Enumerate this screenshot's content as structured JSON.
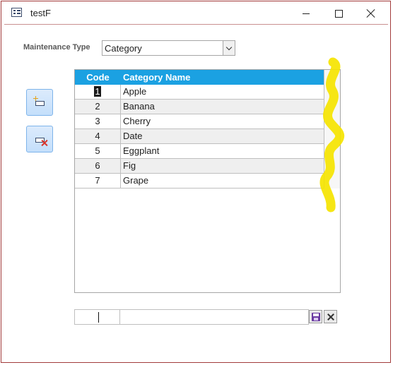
{
  "window": {
    "title": "testF",
    "accent_color": "#a23b3b"
  },
  "form": {
    "maintenance_label": "Maintenance Type",
    "maintenance_value": "Category"
  },
  "grid": {
    "header_color": "#1ba1e2",
    "columns": [
      "Code",
      "Category Name"
    ],
    "rows": [
      {
        "code": "1",
        "name": "Apple"
      },
      {
        "code": "2",
        "name": "Banana"
      },
      {
        "code": "3",
        "name": "Cherry"
      },
      {
        "code": "4",
        "name": "Date"
      },
      {
        "code": "5",
        "name": "Eggplant"
      },
      {
        "code": "6",
        "name": "Fig"
      },
      {
        "code": "7",
        "name": "Grape"
      }
    ],
    "selected_row_index": 0
  },
  "footer": {
    "code_value": "",
    "name_value": ""
  },
  "icons": {
    "new": "new-record-icon",
    "delete": "delete-record-icon",
    "save": "save-disk-icon",
    "cancel": "cancel-x-icon"
  },
  "annotation_color": "#f5e400"
}
